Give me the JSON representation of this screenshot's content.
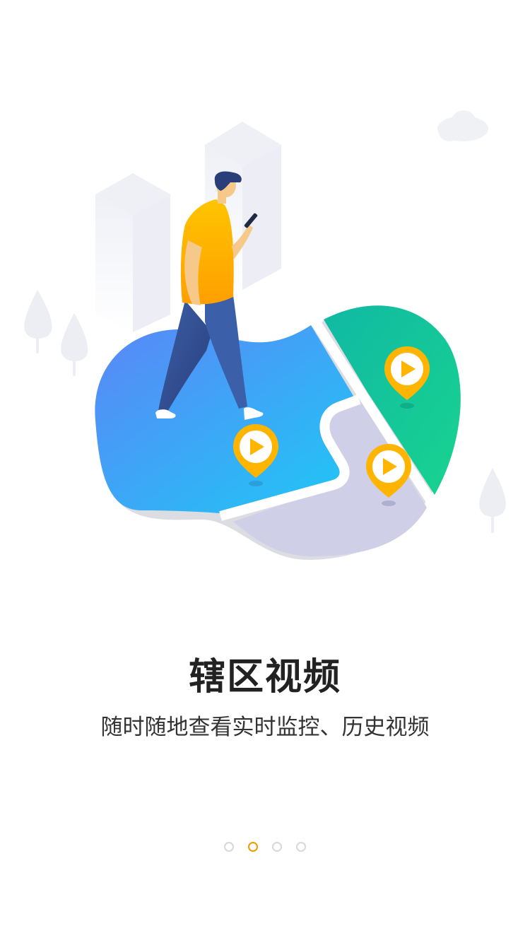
{
  "onboarding": {
    "title": "辖区视频",
    "subtitle": "随时随地查看实时监控、历史视频",
    "page_indicator": {
      "total": 4,
      "active_index": 1
    }
  },
  "colors": {
    "accent": "#f39800",
    "map_blue_start": "#5b86f7",
    "map_blue_end": "#1ec8f5",
    "map_green": "#15c79e",
    "map_gray": "#cfd0e8",
    "pin_yellow": "#ffb400",
    "dot_inactive": "#d8d8d8"
  },
  "icons": {
    "pins": [
      "video-play-pin-icon",
      "video-play-pin-icon",
      "video-play-pin-icon"
    ]
  }
}
